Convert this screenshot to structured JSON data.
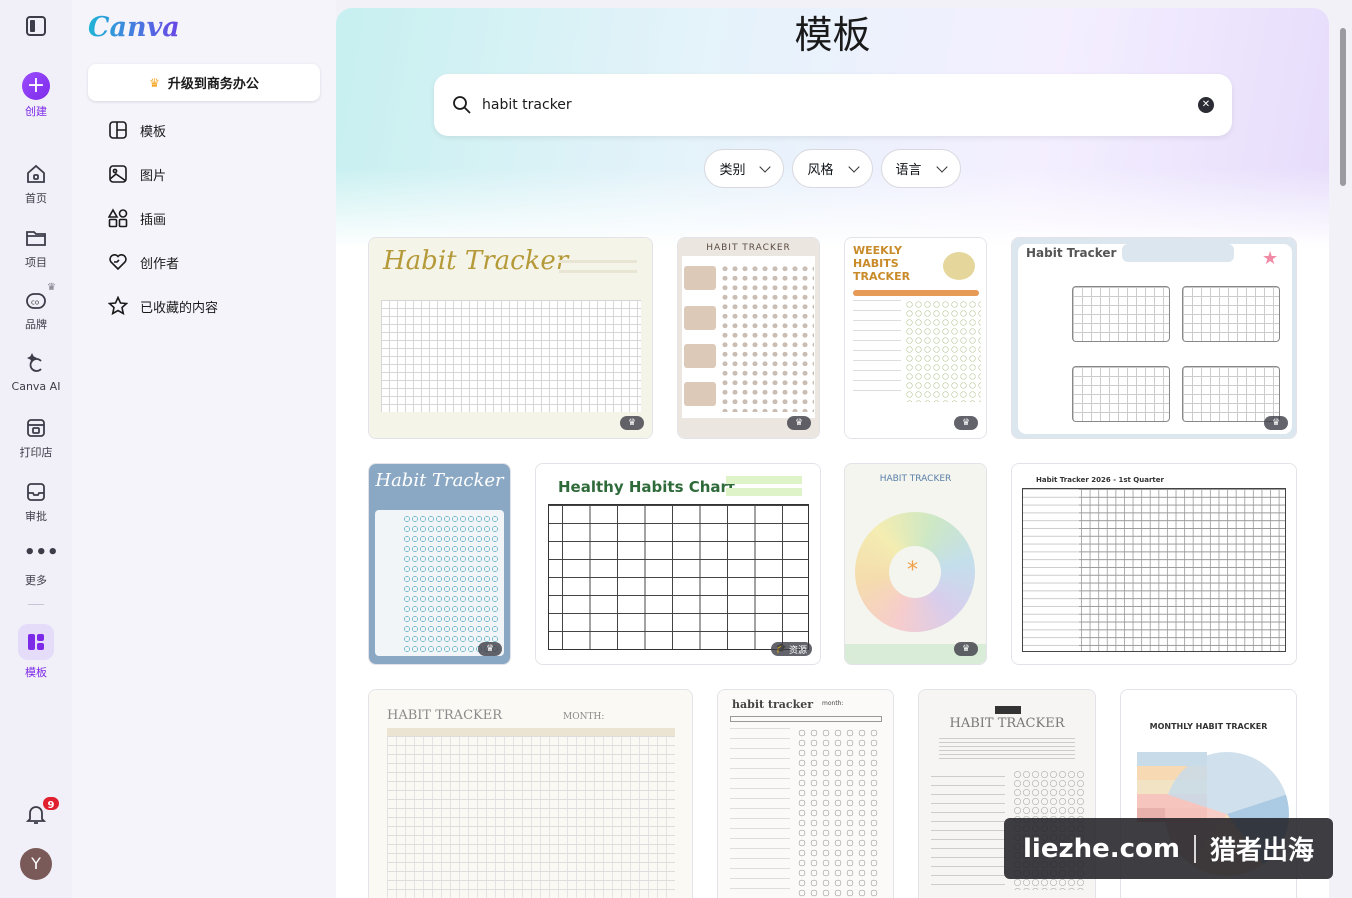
{
  "rail": {
    "create": "创建",
    "home": "首页",
    "projects": "项目",
    "brand": "品牌",
    "ai": "Canva AI",
    "print": "打印店",
    "approval": "审批",
    "more": "更多",
    "templates": "模板",
    "notifications": "9",
    "avatar": "Y"
  },
  "panel": {
    "logo": "Canva",
    "upgrade": "升级到商务办公",
    "items": [
      {
        "label": "模板",
        "icon": "layout-icon"
      },
      {
        "label": "图片",
        "icon": "image-icon"
      },
      {
        "label": "插画",
        "icon": "shapes-icon"
      },
      {
        "label": "创作者",
        "icon": "heart-icon"
      },
      {
        "label": "已收藏的内容",
        "icon": "star-icon"
      }
    ]
  },
  "main": {
    "title": "模板",
    "search_value": "habit tracker",
    "filters": [
      "类别",
      "风格",
      "语言"
    ],
    "cards": [
      {
        "title": "Habit Tracker"
      },
      {
        "title": "HABIT TRACKER"
      },
      {
        "title": "WEEKLY HABITS TRACKER"
      },
      {
        "title": "Habit Tracker"
      },
      {
        "title": "Habit Tracker"
      },
      {
        "title": "Healthy Habits Chart",
        "badge": "资源"
      },
      {
        "title": "HABIT TRACKER"
      },
      {
        "title": "Habit Tracker 2026 - 1st Quarter"
      },
      {
        "title": "HABIT TRACKER",
        "subtitle": "MONTH:"
      },
      {
        "title": "habit tracker",
        "subtitle": "month:"
      },
      {
        "title": "HABIT TRACKER"
      },
      {
        "title": "MONTHLY HABIT TRACKER"
      }
    ]
  },
  "watermark": {
    "site": "liezhe.com",
    "brand": "猎者出海"
  }
}
